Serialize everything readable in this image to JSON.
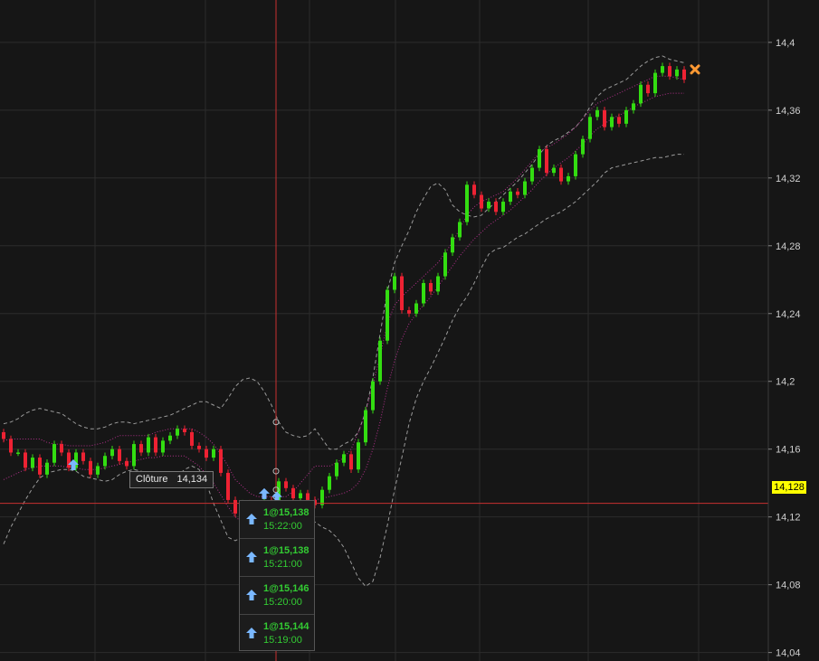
{
  "chart_data": {
    "type": "candlestick",
    "ylim": [
      14.035,
      14.425
    ],
    "y_ticks": [
      "14,4",
      "14,36",
      "14,32",
      "14,28",
      "14,24",
      "14,2",
      "14,16",
      "14,12",
      "14,08",
      "14,04"
    ],
    "y_tick_values": [
      14.4,
      14.36,
      14.32,
      14.28,
      14.24,
      14.2,
      14.16,
      14.12,
      14.08,
      14.04
    ],
    "current_price_label": "14,128",
    "current_price": 14.128,
    "grid": true,
    "colors": {
      "background": "#161616",
      "up": "#33dd11",
      "down": "#ee2233",
      "grid": "#2c2c2c",
      "crosshair": "#c83030",
      "bollinger": "#9a9a9a",
      "channel": "#b0308a",
      "price_tag": "#ffff00",
      "marker": "#ff9933"
    },
    "closes": [
      14.166,
      14.158,
      14.158,
      14.149,
      14.155,
      14.145,
      14.152,
      14.163,
      14.158,
      14.149,
      14.158,
      14.153,
      14.145,
      14.15,
      14.156,
      14.16,
      14.153,
      14.15,
      14.163,
      14.158,
      14.167,
      14.158,
      14.165,
      14.168,
      14.172,
      14.17,
      14.162,
      14.16,
      14.155,
      14.16,
      14.146,
      14.13,
      14.122,
      14.128,
      14.118,
      14.124,
      14.13,
      14.128,
      14.141,
      14.137,
      14.131,
      14.134,
      14.13,
      14.127,
      14.136,
      14.144,
      14.152,
      14.157,
      14.148,
      14.164,
      14.183,
      14.2,
      14.224,
      14.254,
      14.262,
      14.242,
      14.24,
      14.246,
      14.258,
      14.253,
      14.262,
      14.276,
      14.285,
      14.294,
      14.316,
      14.31,
      14.302,
      14.306,
      14.3,
      14.306,
      14.312,
      14.31,
      14.318,
      14.326,
      14.337,
      14.323,
      14.326,
      14.318,
      14.321,
      14.334,
      14.343,
      14.356,
      14.36,
      14.35,
      14.356,
      14.352,
      14.36,
      14.364,
      14.375,
      14.37,
      14.382,
      14.386,
      14.38,
      14.384,
      14.378
    ],
    "bollinger_upper": [
      14.175,
      14.176,
      14.178,
      14.181,
      14.183,
      14.184,
      14.183,
      14.182,
      14.181,
      14.178,
      14.175,
      14.173,
      14.172,
      14.172,
      14.173,
      14.175,
      14.176,
      14.176,
      14.175,
      14.176,
      14.177,
      14.178,
      14.179,
      14.18,
      14.182,
      14.184,
      14.186,
      14.188,
      14.188,
      14.186,
      14.184,
      14.19,
      14.197,
      14.201,
      14.202,
      14.2,
      14.194,
      14.186,
      14.176,
      14.17,
      14.168,
      14.167,
      14.168,
      14.172,
      14.166,
      14.16,
      14.16,
      14.163,
      14.165,
      14.17,
      14.182,
      14.202,
      14.228,
      14.253,
      14.27,
      14.28,
      14.289,
      14.3,
      14.308,
      14.315,
      14.317,
      14.313,
      14.304,
      14.3,
      14.298,
      14.297,
      14.298,
      14.302,
      14.306,
      14.31,
      14.314,
      14.318,
      14.323,
      14.328,
      14.334,
      14.339,
      14.342,
      14.344,
      14.347,
      14.35,
      14.355,
      14.362,
      14.368,
      14.372,
      14.374,
      14.376,
      14.378,
      14.382,
      14.386,
      14.389,
      14.391,
      14.392,
      14.39,
      14.389,
      14.388
    ],
    "bollinger_lower": [
      14.104,
      14.114,
      14.122,
      14.13,
      14.137,
      14.143,
      14.146,
      14.147,
      14.148,
      14.148,
      14.147,
      14.144,
      14.143,
      14.142,
      14.141,
      14.142,
      14.145,
      14.147,
      14.148,
      14.147,
      14.145,
      14.143,
      14.142,
      14.142,
      14.144,
      14.148,
      14.15,
      14.148,
      14.14,
      14.128,
      14.118,
      14.108,
      14.106,
      14.108,
      14.11,
      14.112,
      14.115,
      14.118,
      14.121,
      14.122,
      14.123,
      14.122,
      14.121,
      14.117,
      14.114,
      14.112,
      14.108,
      14.102,
      14.093,
      14.084,
      14.079,
      14.082,
      14.096,
      14.115,
      14.136,
      14.155,
      14.175,
      14.19,
      14.2,
      14.208,
      14.217,
      14.226,
      14.236,
      14.244,
      14.25,
      14.258,
      14.267,
      14.275,
      14.278,
      14.279,
      14.282,
      14.285,
      14.287,
      14.29,
      14.293,
      14.296,
      14.298,
      14.3,
      14.303,
      14.306,
      14.31,
      14.314,
      14.318,
      14.323,
      14.326,
      14.327,
      14.328,
      14.329,
      14.33,
      14.331,
      14.332,
      14.332,
      14.333,
      14.334,
      14.334
    ],
    "channel_upper": [
      14.165,
      14.166,
      14.166,
      14.166,
      14.166,
      14.166,
      14.164,
      14.163,
      14.163,
      14.162,
      14.162,
      14.162,
      14.162,
      14.163,
      14.164,
      14.166,
      14.168,
      14.168,
      14.168,
      14.168,
      14.168,
      14.17,
      14.171,
      14.172,
      14.172,
      14.172,
      14.172,
      14.17,
      14.167,
      14.163,
      14.157,
      14.15,
      14.142,
      14.138,
      14.134,
      14.132,
      14.132,
      14.132,
      14.132,
      14.132,
      14.135,
      14.14,
      14.145,
      14.15,
      14.15,
      14.15,
      14.152,
      14.155,
      14.16,
      14.17,
      14.182,
      14.198,
      14.215,
      14.234,
      14.245,
      14.25,
      14.254,
      14.258,
      14.262,
      14.266,
      14.27,
      14.276,
      14.282,
      14.29,
      14.298,
      14.303,
      14.306,
      14.308,
      14.31,
      14.312,
      14.316,
      14.32,
      14.325,
      14.33,
      14.335,
      14.338,
      14.34,
      14.343,
      14.346,
      14.35,
      14.355,
      14.36,
      14.364,
      14.366,
      14.368,
      14.37,
      14.372,
      14.374,
      14.376,
      14.378,
      14.38,
      14.38,
      14.38,
      14.379,
      14.378
    ],
    "channel_lower": [
      14.142,
      14.144,
      14.146,
      14.148,
      14.149,
      14.15,
      14.15,
      14.15,
      14.15,
      14.149,
      14.149,
      14.148,
      14.148,
      14.148,
      14.149,
      14.15,
      14.151,
      14.152,
      14.153,
      14.154,
      14.155,
      14.155,
      14.156,
      14.156,
      14.156,
      14.156,
      14.153,
      14.15,
      14.145,
      14.14,
      14.133,
      14.126,
      14.12,
      14.117,
      14.115,
      14.114,
      14.114,
      14.115,
      14.117,
      14.12,
      14.123,
      14.126,
      14.128,
      14.13,
      14.131,
      14.132,
      14.133,
      14.134,
      14.136,
      14.14,
      14.148,
      14.16,
      14.176,
      14.196,
      14.212,
      14.225,
      14.234,
      14.24,
      14.245,
      14.25,
      14.256,
      14.262,
      14.268,
      14.274,
      14.279,
      14.284,
      14.288,
      14.292,
      14.295,
      14.298,
      14.301,
      14.305,
      14.309,
      14.313,
      14.318,
      14.322,
      14.326,
      14.329,
      14.332,
      14.336,
      14.34,
      14.345,
      14.349,
      14.352,
      14.355,
      14.357,
      14.359,
      14.362,
      14.364,
      14.366,
      14.368,
      14.369,
      14.37,
      14.37,
      14.37
    ]
  },
  "tooltip": {
    "label": "Clôture",
    "value": "14,134"
  },
  "trades": [
    {
      "qty": "1@15,138",
      "time": "15:22:00"
    },
    {
      "qty": "1@15,138",
      "time": "15:21:00"
    },
    {
      "qty": "1@15,146",
      "time": "15:20:00"
    },
    {
      "qty": "1@15,144",
      "time": "15:19:00"
    }
  ],
  "trade_count_label": "4",
  "icons": {
    "trade_arrow": "up-arrow-icon",
    "exit_marker": "x-marker-icon"
  }
}
